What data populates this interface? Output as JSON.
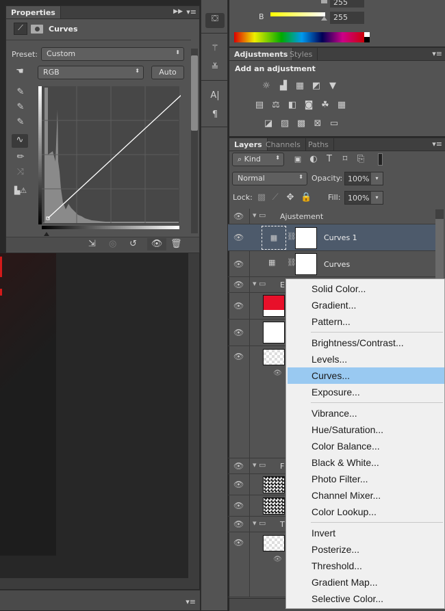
{
  "properties": {
    "tab": "Properties",
    "title": "Curves",
    "preset_label": "Preset:",
    "preset_value": "Custom",
    "channel_value": "RGB",
    "auto_label": "Auto"
  },
  "color": {
    "b_label": "B",
    "g_value": "255",
    "b_value": "255"
  },
  "adjustments": {
    "tabs": [
      "Adjustments",
      "Styles"
    ],
    "heading": "Add an adjustment"
  },
  "layers": {
    "tabs": [
      "Layers",
      "Channels",
      "Paths"
    ],
    "kind_label": "Kind",
    "blend_mode": "Normal",
    "opacity_label": "Opacity:",
    "opacity_value": "100%",
    "lock_label": "Lock:",
    "fill_label": "Fill:",
    "fill_value": "100%",
    "items": [
      {
        "name": "Ajustement",
        "type": "group"
      },
      {
        "name": "Curves 1",
        "type": "curves",
        "selected": true
      },
      {
        "name": "Curves",
        "type": "curves"
      },
      {
        "name": "E",
        "type": "group"
      },
      {
        "name": "",
        "type": "fill",
        "color": "#e8102a"
      },
      {
        "name": "",
        "type": "fill",
        "color": "#ffffff"
      },
      {
        "name": "",
        "type": "smart"
      },
      {
        "name": "F",
        "type": "group"
      },
      {
        "name": "",
        "type": "noise"
      },
      {
        "name": "",
        "type": "noise"
      },
      {
        "name": "T",
        "type": "group"
      },
      {
        "name": "",
        "type": "smart"
      }
    ]
  },
  "context_menu": {
    "items": [
      "Solid Color...",
      "Gradient...",
      "Pattern...",
      "Brightness/Contrast...",
      "Levels...",
      "Curves...",
      "Exposure...",
      "Vibrance...",
      "Hue/Saturation...",
      "Color Balance...",
      "Black & White...",
      "Photo Filter...",
      "Channel Mixer...",
      "Color Lookup...",
      "Invert",
      "Posterize...",
      "Threshold...",
      "Gradient Map...",
      "Selective Color..."
    ],
    "highlighted": "Curves...",
    "highlight_color": "#99c9f1"
  }
}
